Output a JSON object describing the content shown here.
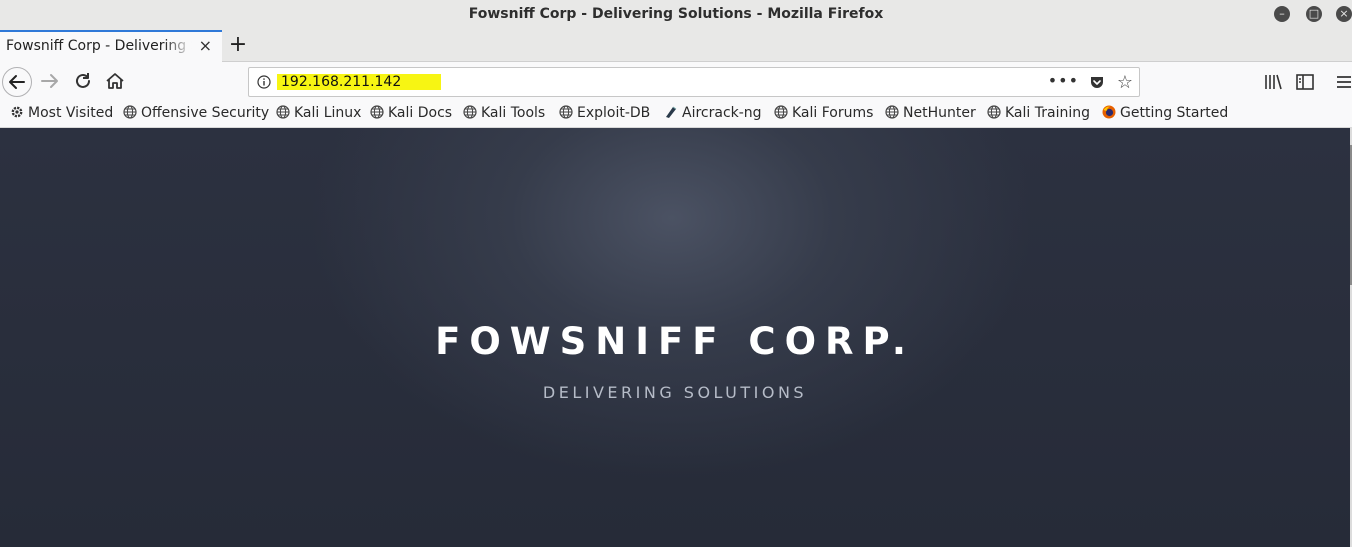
{
  "window": {
    "title": "Fowsniff Corp - Delivering Solutions - Mozilla Firefox",
    "minimize_glyph": "–",
    "maximize_glyph": "□",
    "close_glyph": "×"
  },
  "tabs": [
    {
      "label": "Fowsniff Corp - Delivering Solutions",
      "close_glyph": "×"
    }
  ],
  "new_tab_glyph": "+",
  "navbar": {
    "url": "192.168.211.142",
    "url_highlight_color": "#f7f513",
    "more_glyph": "•••",
    "star_glyph": "☆",
    "icons": [
      "back-icon",
      "forward-icon",
      "reload-icon",
      "home-icon",
      "info-icon",
      "pocket-icon",
      "bookmark-star-icon",
      "library-icon",
      "sidebar-icon",
      "menu-icon"
    ]
  },
  "bookmarks": [
    {
      "label": "Most Visited",
      "icon": "gear-icon"
    },
    {
      "label": "Offensive Security",
      "icon": "globe-icon"
    },
    {
      "label": "Kali Linux",
      "icon": "globe-icon"
    },
    {
      "label": "Kali Docs",
      "icon": "globe-icon"
    },
    {
      "label": "Kali Tools",
      "icon": "globe-icon"
    },
    {
      "label": "Exploit-DB",
      "icon": "globe-icon"
    },
    {
      "label": "Aircrack-ng",
      "icon": "aircrack-icon"
    },
    {
      "label": "Kali Forums",
      "icon": "globe-icon"
    },
    {
      "label": "NetHunter",
      "icon": "globe-icon"
    },
    {
      "label": "Kali Training",
      "icon": "globe-icon"
    },
    {
      "label": "Getting Started",
      "icon": "firefox-icon"
    }
  ],
  "page": {
    "title": "FOWSNIFF CORP.",
    "subtitle": "DELIVERING SOLUTIONS",
    "background_color": "#2a2f3d",
    "title_color": "#ffffff",
    "subtitle_color": "#b6bcc8"
  }
}
